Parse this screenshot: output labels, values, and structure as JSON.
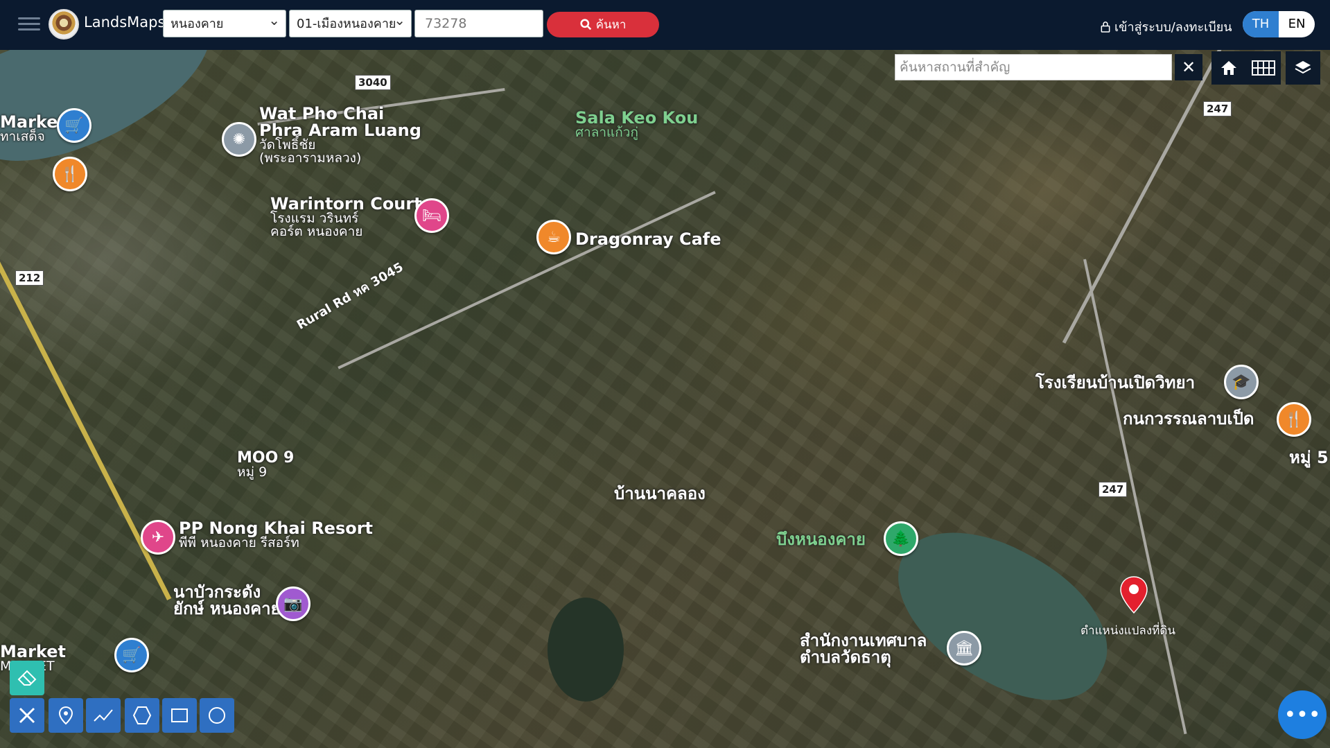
{
  "header": {
    "brand": "LandsMaps",
    "province": "หนองคาย",
    "district": "01-เมืองหนองคาย",
    "parcel_number": "73278",
    "search_label": "ค้นหา",
    "login_label": "เข้าสู่ระบบ/ลงทะเบียน",
    "lang_th": "TH",
    "lang_en": "EN"
  },
  "map_controls": {
    "poi_placeholder": "ค้นหาสถานที่สำคัญ",
    "clear": "✕"
  },
  "map_labels": {
    "market_top": "Market",
    "market_top_th": "ทาเสด็จ",
    "wat_en1": "Wat Pho Chai",
    "wat_en2": "Phra Aram Luang",
    "wat_th1": "วัดโพธิ์ชัย",
    "wat_th2": "(พระอารามหลวง)",
    "sala": "Sala Keo Kou",
    "sala_th": "ศาลาแก้วกู่",
    "warintorn": "Warintorn Court",
    "warintorn_th1": "โรงแรม วรินทร์",
    "warintorn_th2": "คอร์ต หนองคาย",
    "dragonray": "Dragonray Cafe",
    "rural_rd": "Rural Rd หค 3045",
    "moo9": "MOO 9",
    "moo9_th": "หมู่ 9",
    "ban_na_khlong": "บ้านนาคลอง",
    "school": "โรงเรียนบ้านเปิดวิทยา",
    "restaurant": "กนกวรรณลาบเป็ด",
    "moo5": "หมู่ 5",
    "pp_resort": "PP Nong Khai Resort",
    "pp_resort_th": "พีพี หนองคาย รีสอร์ท",
    "bueng": "บึงหนองคาย",
    "na_bua1": "นาบัวกระดัง",
    "na_bua2": "ยักษ์ หนองคาย",
    "office1": "สำนักงานเทศบาล",
    "office2": "ตำบลวัดธาตุ",
    "market_bottom1": "Market",
    "market_bottom2": "MARKET",
    "parcel_position": "ตำแหน่งแปลงที่ดิน",
    "shield_3040": "3040",
    "shield_212": "212",
    "shield_247a": "247",
    "shield_247b": "247"
  }
}
